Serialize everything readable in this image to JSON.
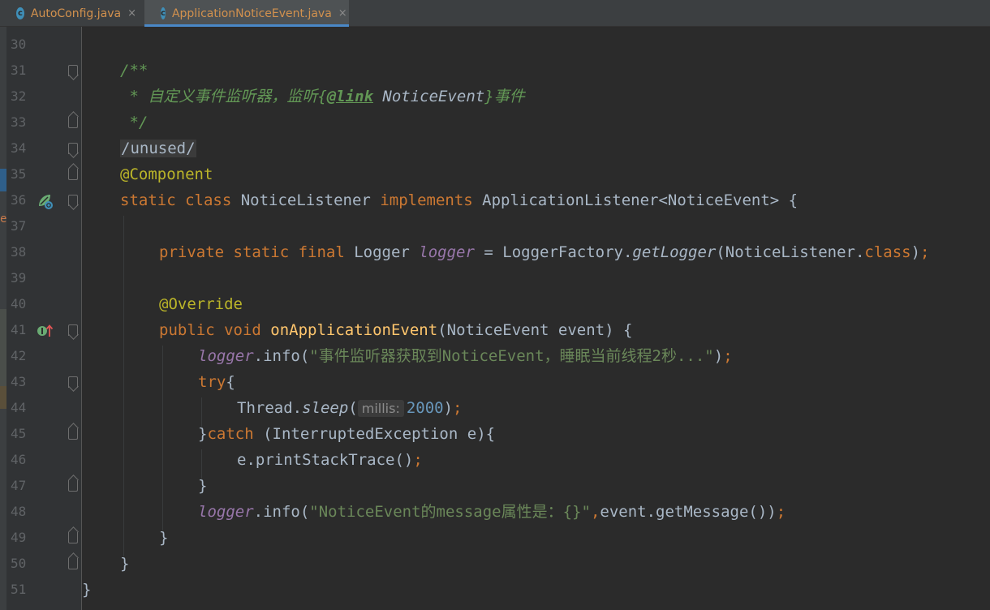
{
  "tabs": [
    {
      "label": "AutoConfig.java",
      "icon": "class-icon",
      "icon_glyph": "c",
      "active": false
    },
    {
      "label": "ApplicationNoticeEvent.java",
      "icon": "class-icon",
      "icon_glyph": "c",
      "active": true
    }
  ],
  "close_glyph": "×",
  "edge_marker": "e",
  "line_numbers": [
    "30",
    "31",
    "32",
    "33",
    "34",
    "35",
    "36",
    "37",
    "38",
    "39",
    "40",
    "41",
    "42",
    "43",
    "44",
    "45",
    "46",
    "47",
    "48",
    "49",
    "50",
    "51"
  ],
  "code": {
    "l31": {
      "t1": "/**"
    },
    "l32": {
      "t1": " * 自定义事件监听器，监听{",
      "tag": "@link",
      "ref": " NoticeEvent",
      "t2": "}事件"
    },
    "l33": {
      "t1": " */"
    },
    "l34": {
      "t1": "/unused/"
    },
    "l35": {
      "t1": "@Component"
    },
    "l36": {
      "k1": "static class ",
      "t1": "NoticeListener ",
      "k2": "implements ",
      "t2": "ApplicationListener<NoticeEvent> {"
    },
    "l38": {
      "k1": "private static final ",
      "t1": "Logger ",
      "f1": "logger",
      "t2": " = LoggerFactory.",
      "m1": "getLogger",
      "t3": "(NoticeListener.",
      "k2": "class",
      "t4": ")",
      "k3": ";"
    },
    "l40": {
      "t1": "@Override"
    },
    "l41": {
      "k1": "public void ",
      "f1": "onApplicationEvent",
      "t1": "(NoticeEvent event) {"
    },
    "l42": {
      "f1": "logger",
      "t1": ".info(",
      "s1": "\"事件监听器获取到NoticeEvent，睡眠当前线程2秒...\"",
      "t2": ")",
      "k1": ";"
    },
    "l43": {
      "k1": "try",
      "t1": "{"
    },
    "l44": {
      "t1": "Thread.",
      "m1": "sleep",
      "t2": "(",
      "hint": "millis:",
      "n1": "2000",
      "t3": ")",
      "k1": ";"
    },
    "l45": {
      "t1": "}",
      "k1": "catch ",
      "t2": "(InterruptedException e){"
    },
    "l46": {
      "t1": "e.printStackTrace()",
      "k1": ";"
    },
    "l47": {
      "t1": "}"
    },
    "l48": {
      "f1": "logger",
      "t1": ".info(",
      "s1": "\"NoticeEvent的message属性是：{}\"",
      "k1": ",",
      "t2": "event.getMessage())",
      "k2": ";"
    },
    "l49": {
      "t1": "}"
    },
    "l50": {
      "t1": "}"
    },
    "l51": {
      "t1": "}"
    }
  },
  "gutter_icons": {
    "l36": "spring-bean-icon",
    "l41": "implements-method-icon"
  },
  "colors": {
    "background": "#2b2b2b",
    "keyword": "#cc7832",
    "comment": "#629755",
    "annotation": "#bbb529",
    "method": "#ffc66d",
    "field": "#9876aa",
    "string": "#6a8759",
    "number": "#6897bb"
  }
}
